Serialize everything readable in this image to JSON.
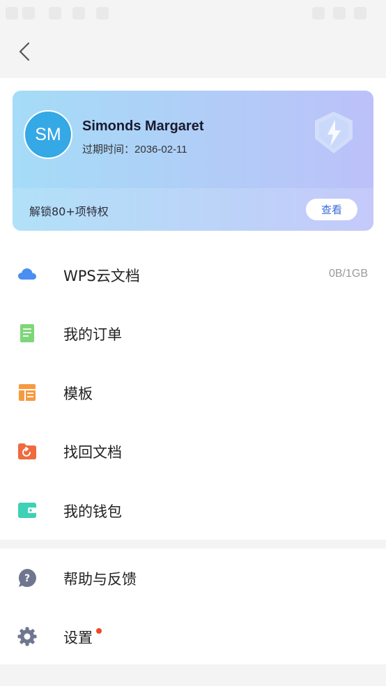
{
  "header": {
    "back_icon": "chevron-left-icon"
  },
  "member_card": {
    "avatar_initials": "SM",
    "username": "Simonds Margaret",
    "expiry_label": "过期时间：",
    "expiry_date": "2036-02-11",
    "unlock_text": "解锁80+项特权",
    "view_button": "查看"
  },
  "menu": [
    {
      "label": "WPS云文档",
      "value": "0B/1GB",
      "icon": "cloud-icon"
    },
    {
      "label": "我的订单",
      "icon": "order-icon"
    },
    {
      "label": "模板",
      "icon": "template-icon"
    },
    {
      "label": "找回文档",
      "icon": "recover-folder-icon"
    },
    {
      "label": "我的钱包",
      "icon": "wallet-icon"
    }
  ],
  "menu2": [
    {
      "label": "帮助与反馈",
      "icon": "help-icon"
    },
    {
      "label": "设置",
      "icon": "gear-icon",
      "badge": "red-dot"
    }
  ],
  "colors": {
    "accent": "#3a6bd9",
    "avatar": "#35a8e6",
    "cloud": "#4a8ef0",
    "order": "#7ed67a",
    "template": "#f79a3e",
    "recover": "#ef6a3d",
    "wallet": "#3ed1b5",
    "help": "#6f7690",
    "settings": "#6f7690",
    "notification": "#f24822"
  }
}
